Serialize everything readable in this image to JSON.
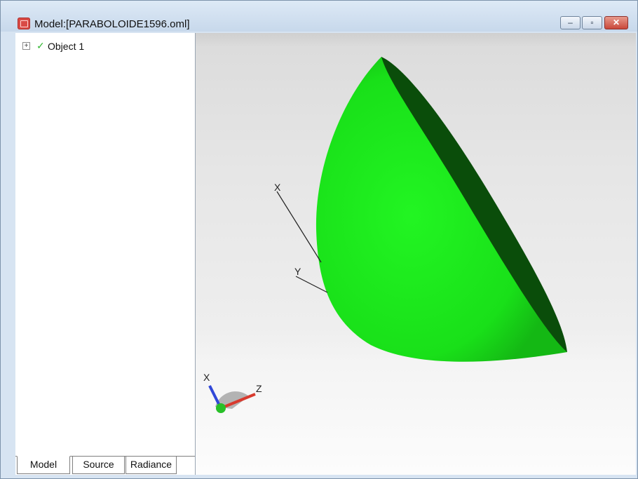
{
  "window": {
    "title": "Model:[PARABOLOIDE1596.oml]",
    "controls": {
      "minimize": "–",
      "maximize": "▫",
      "close": "✕"
    }
  },
  "tree": {
    "items": [
      {
        "expander": "+",
        "status_icon": "check-icon",
        "label": "Object 1"
      }
    ]
  },
  "tabs": [
    {
      "label": "Model",
      "active": true
    },
    {
      "label": "Source",
      "active": false
    },
    {
      "label": "Radiance",
      "active": false
    }
  ],
  "viewport": {
    "axis_labels": {
      "x": "X",
      "y": "Y"
    },
    "triad_labels": {
      "x": "X",
      "z": "Z"
    },
    "colors": {
      "surface_outer": "#18e818",
      "surface_inner": "#0a4d0a",
      "triad_x": "#3148d8",
      "triad_z": "#d83a2e",
      "triad_y": "#28c028"
    }
  }
}
